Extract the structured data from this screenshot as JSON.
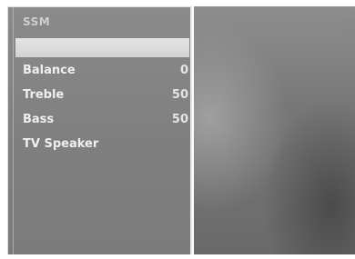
{
  "menu": {
    "title": "SSM",
    "highlighted_item": "",
    "items": [
      {
        "label": "Balance",
        "value": "0"
      },
      {
        "label": "Treble",
        "value": "50"
      },
      {
        "label": "Bass",
        "value": "50"
      },
      {
        "label": "TV Speaker",
        "value": ""
      }
    ]
  },
  "colors": {
    "panel": "#828282",
    "highlight": "#dcdcdc",
    "text": "#efefef",
    "border": "#e6e6e6"
  }
}
